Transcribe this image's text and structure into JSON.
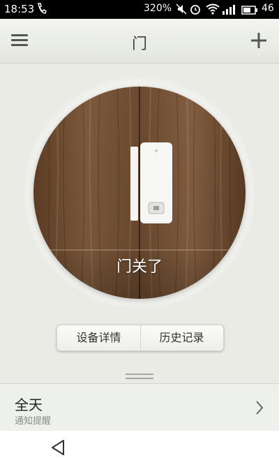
{
  "status_bar": {
    "time": "18:53",
    "battery_percent": "320%",
    "network_type": "46",
    "icons": [
      "phone-icon",
      "mute-icon",
      "alarm-icon",
      "wifi-icon",
      "signal-icon",
      "battery-icon"
    ]
  },
  "header": {
    "title": "门",
    "menu_icon": "hamburger-menu-icon",
    "add_icon": "plus-icon"
  },
  "door": {
    "status": "门关了"
  },
  "segmented": {
    "details_label": "设备详情",
    "history_label": "历史记录"
  },
  "notify": {
    "main": "全天",
    "sub": "通知提醒",
    "icon": "chevron-right-icon"
  },
  "nav": {
    "back_icon": "back-triangle-icon"
  },
  "colors": {
    "wood_dark": "#5a3a22",
    "wood_light": "#8a6444",
    "background": "#e9ebe4"
  }
}
